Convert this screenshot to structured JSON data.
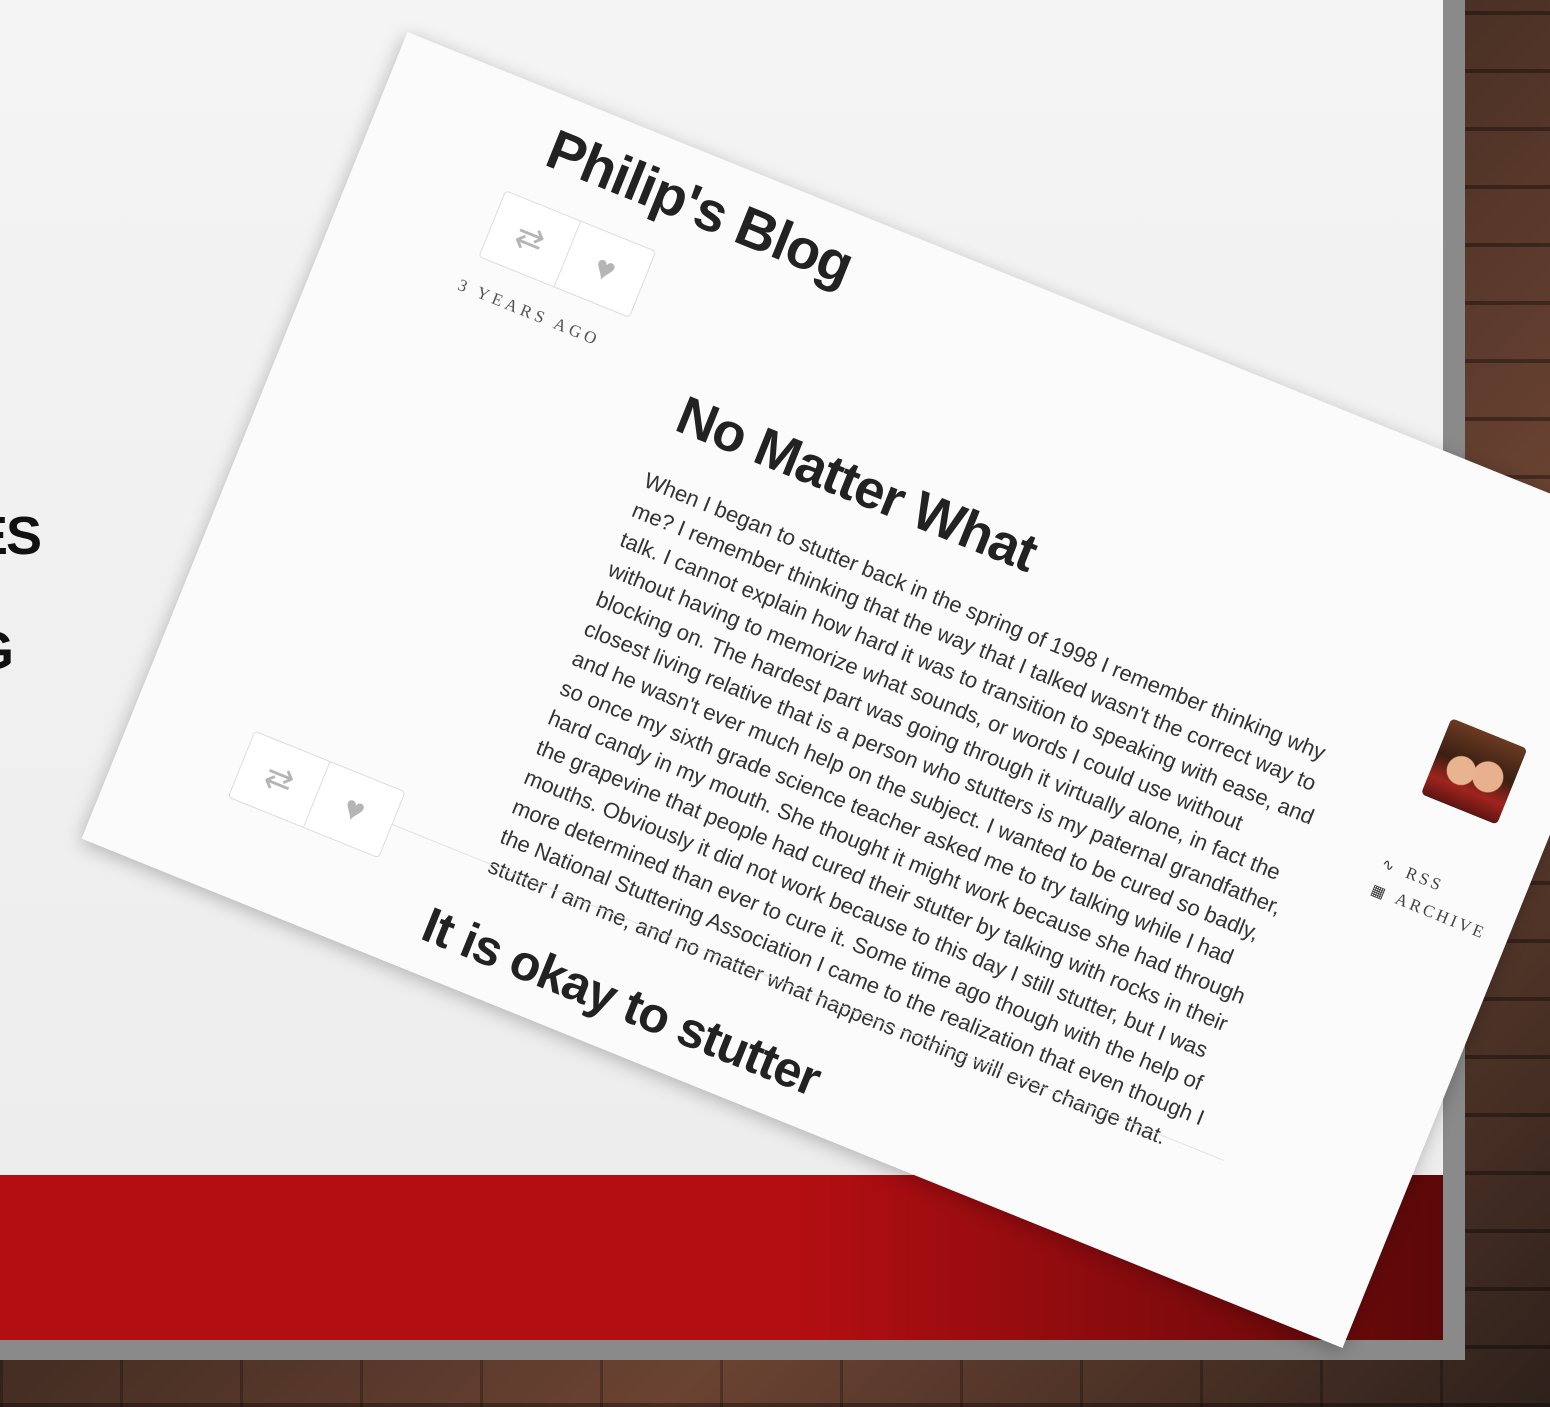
{
  "slide": {
    "partial_text_1": "ES",
    "partial_text_2": "G"
  },
  "blog": {
    "title": "Philip's Blog",
    "sidebar": {
      "rss_label": "RSS",
      "archive_label": "ARCHIVE"
    },
    "posts": [
      {
        "date": "3 YEARS AGO",
        "title": "No Matter What",
        "body": "When I began to stutter back in the spring of 1998 I remember thinking why me? I remember thinking that the way that I talked wasn't the correct way to talk. I cannot explain how hard it was to transition to speaking with ease, and without having to memorize what sounds, or words I could use without blocking on. The hardest part was going through it virtually alone, in fact the closest living relative that is a person who stutters is my paternal grandfather, and he wasn't ever much help on the subject. I wanted to be cured so badly, so once my sixth grade science teacher asked me to try talking while I had hard candy in my mouth. She thought it might work because she had through the grapevine that people had cured their stutter by talking with rocks in their mouths. Obviously it did not work because to this day I still stutter, but I was more determined than ever to cure it. Some time ago though with the help of the National Stuttering Association I came to the realization that even though I stutter I am me, and no matter what happens nothing will ever change that."
      },
      {
        "title": "It is okay to stutter"
      }
    ],
    "icons": {
      "reblog": "reblog-icon",
      "like": "heart-icon",
      "rss": "rss-icon",
      "archive": "archive-icon"
    }
  }
}
